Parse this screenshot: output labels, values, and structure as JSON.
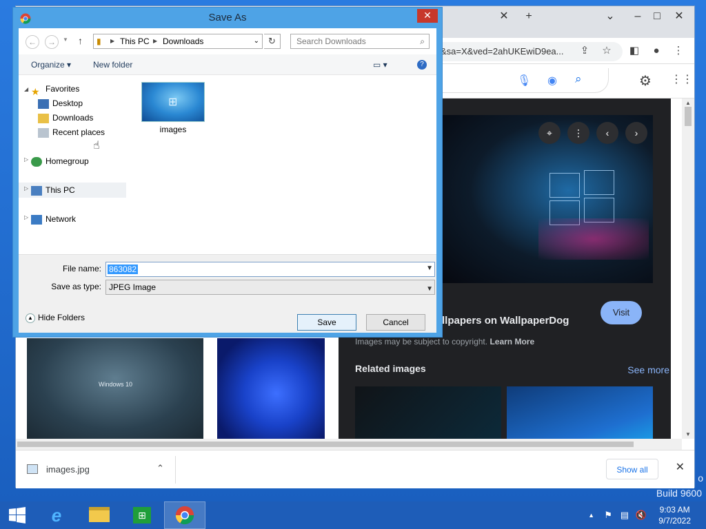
{
  "desktop": {
    "build": "Build 9600",
    "build_partial": "o"
  },
  "chrome": {
    "url_fragment": "&sa=X&ved=2ahUKEwiD9ea...",
    "viewer": {
      "title": "llpapers on WallpaperDog",
      "visit_label": "Visit",
      "copyright_text": "Images may be subject to copyright.",
      "learn_more": "Learn More",
      "related_label": "Related images",
      "see_more": "See more"
    },
    "thumb_left_text": "Windows 10",
    "download": {
      "file": "images.jpg",
      "show_all": "Show all"
    }
  },
  "dialog": {
    "title": "Save As",
    "breadcrumb": [
      "This PC",
      "Downloads"
    ],
    "search_placeholder": "Search Downloads",
    "organize": "Organize",
    "new_folder": "New folder",
    "nav": {
      "favorites": "Favorites",
      "desktop": "Desktop",
      "downloads": "Downloads",
      "recent": "Recent places",
      "homegroup": "Homegroup",
      "thispc": "This PC",
      "network": "Network"
    },
    "folder_item": "images",
    "file_name_label": "File name:",
    "file_name_value": "863082",
    "save_type_label": "Save as type:",
    "save_type_value": "JPEG Image",
    "hide_folders": "Hide Folders",
    "save": "Save",
    "cancel": "Cancel"
  },
  "taskbar": {
    "time": "9:03 AM",
    "date": "9/7/2022"
  },
  "colors": {
    "titlebar": "#4ea3e6",
    "taskbar": "#1e5db8",
    "close": "#c7382b",
    "link": "#8ab4f8"
  }
}
